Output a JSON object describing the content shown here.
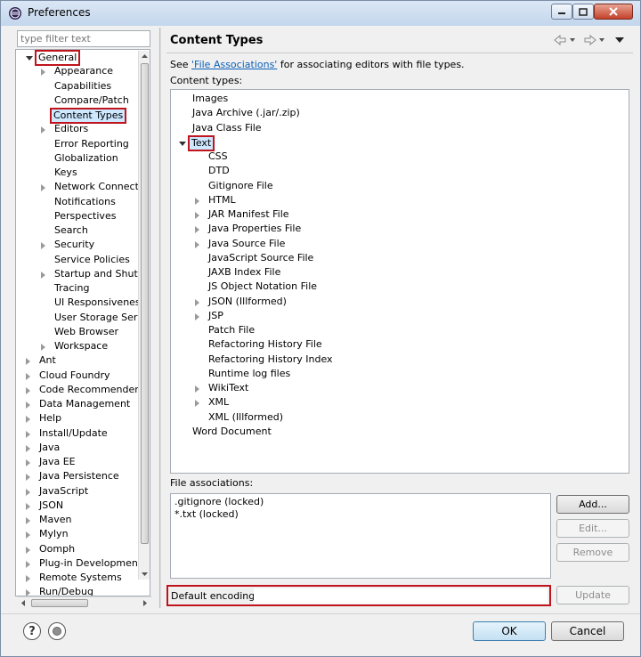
{
  "window": {
    "title": "Preferences",
    "buttons": [
      "minimize",
      "maximize",
      "close"
    ]
  },
  "left": {
    "filter_placeholder": "type filter text",
    "tree": [
      {
        "label": "General",
        "level": 0,
        "state": "expanded",
        "highlighted": true
      },
      {
        "label": "Appearance",
        "level": 1,
        "state": "collapsed"
      },
      {
        "label": "Capabilities",
        "level": 1,
        "state": "leaf"
      },
      {
        "label": "Compare/Patch",
        "level": 1,
        "state": "leaf"
      },
      {
        "label": "Content Types",
        "level": 1,
        "state": "leaf",
        "highlighted": true,
        "selected": true
      },
      {
        "label": "Editors",
        "level": 1,
        "state": "collapsed"
      },
      {
        "label": "Error Reporting",
        "level": 1,
        "state": "leaf"
      },
      {
        "label": "Globalization",
        "level": 1,
        "state": "leaf"
      },
      {
        "label": "Keys",
        "level": 1,
        "state": "leaf"
      },
      {
        "label": "Network Connection",
        "level": 1,
        "state": "collapsed"
      },
      {
        "label": "Notifications",
        "level": 1,
        "state": "leaf"
      },
      {
        "label": "Perspectives",
        "level": 1,
        "state": "leaf"
      },
      {
        "label": "Search",
        "level": 1,
        "state": "leaf"
      },
      {
        "label": "Security",
        "level": 1,
        "state": "collapsed"
      },
      {
        "label": "Service Policies",
        "level": 1,
        "state": "leaf"
      },
      {
        "label": "Startup and Shutdown",
        "level": 1,
        "state": "collapsed"
      },
      {
        "label": "Tracing",
        "level": 1,
        "state": "leaf"
      },
      {
        "label": "UI Responsiveness M",
        "level": 1,
        "state": "leaf"
      },
      {
        "label": "User Storage Service",
        "level": 1,
        "state": "leaf"
      },
      {
        "label": "Web Browser",
        "level": 1,
        "state": "leaf"
      },
      {
        "label": "Workspace",
        "level": 1,
        "state": "collapsed"
      },
      {
        "label": "Ant",
        "level": 0,
        "state": "collapsed"
      },
      {
        "label": "Cloud Foundry",
        "level": 0,
        "state": "collapsed"
      },
      {
        "label": "Code Recommenders",
        "level": 0,
        "state": "collapsed"
      },
      {
        "label": "Data Management",
        "level": 0,
        "state": "collapsed"
      },
      {
        "label": "Help",
        "level": 0,
        "state": "collapsed"
      },
      {
        "label": "Install/Update",
        "level": 0,
        "state": "collapsed"
      },
      {
        "label": "Java",
        "level": 0,
        "state": "collapsed"
      },
      {
        "label": "Java EE",
        "level": 0,
        "state": "collapsed"
      },
      {
        "label": "Java Persistence",
        "level": 0,
        "state": "collapsed"
      },
      {
        "label": "JavaScript",
        "level": 0,
        "state": "collapsed"
      },
      {
        "label": "JSON",
        "level": 0,
        "state": "collapsed"
      },
      {
        "label": "Maven",
        "level": 0,
        "state": "collapsed"
      },
      {
        "label": "Mylyn",
        "level": 0,
        "state": "collapsed"
      },
      {
        "label": "Oomph",
        "level": 0,
        "state": "collapsed"
      },
      {
        "label": "Plug-in Development",
        "level": 0,
        "state": "collapsed"
      },
      {
        "label": "Remote Systems",
        "level": 0,
        "state": "collapsed"
      },
      {
        "label": "Run/Debug",
        "level": 0,
        "state": "collapsed"
      }
    ]
  },
  "right": {
    "title": "Content Types",
    "desc_before": "See ",
    "desc_link": "'File Associations'",
    "desc_after": " for associating editors with file types.",
    "content_types_label": "Content types:",
    "content_types": [
      {
        "label": "Images",
        "level": 0,
        "state": "leaf"
      },
      {
        "label": "Java Archive (.jar/.zip)",
        "level": 0,
        "state": "leaf"
      },
      {
        "label": "Java Class File",
        "level": 0,
        "state": "leaf"
      },
      {
        "label": "Text",
        "level": 0,
        "state": "expanded",
        "highlighted": true,
        "selected": true
      },
      {
        "label": "CSS",
        "level": 1,
        "state": "leaf"
      },
      {
        "label": "DTD",
        "level": 1,
        "state": "leaf"
      },
      {
        "label": "Gitignore File",
        "level": 1,
        "state": "leaf"
      },
      {
        "label": "HTML",
        "level": 1,
        "state": "collapsed"
      },
      {
        "label": "JAR Manifest File",
        "level": 1,
        "state": "collapsed"
      },
      {
        "label": "Java Properties File",
        "level": 1,
        "state": "collapsed"
      },
      {
        "label": "Java Source File",
        "level": 1,
        "state": "collapsed"
      },
      {
        "label": "JavaScript Source File",
        "level": 1,
        "state": "leaf"
      },
      {
        "label": "JAXB Index File",
        "level": 1,
        "state": "leaf"
      },
      {
        "label": "JS Object Notation File",
        "level": 1,
        "state": "leaf"
      },
      {
        "label": "JSON (Illformed)",
        "level": 1,
        "state": "collapsed"
      },
      {
        "label": "JSP",
        "level": 1,
        "state": "collapsed"
      },
      {
        "label": "Patch File",
        "level": 1,
        "state": "leaf"
      },
      {
        "label": "Refactoring History File",
        "level": 1,
        "state": "leaf"
      },
      {
        "label": "Refactoring History Index",
        "level": 1,
        "state": "leaf"
      },
      {
        "label": "Runtime log files",
        "level": 1,
        "state": "leaf"
      },
      {
        "label": "WikiText",
        "level": 1,
        "state": "collapsed"
      },
      {
        "label": "XML",
        "level": 1,
        "state": "collapsed"
      },
      {
        "label": "XML (Illformed)",
        "level": 1,
        "state": "leaf"
      },
      {
        "label": "Word Document",
        "level": 0,
        "state": "leaf"
      }
    ],
    "file_assoc_label": "File associations:",
    "file_associations": [
      ".gitignore (locked)",
      "*.txt (locked)"
    ],
    "buttons": {
      "add": "Add...",
      "edit": "Edit...",
      "remove": "Remove",
      "update": "Update"
    },
    "encoding_label": "Default encoding:",
    "encoding_value": ""
  },
  "footer": {
    "ok": "OK",
    "cancel": "Cancel",
    "help_glyph": "?"
  },
  "colors": {
    "highlight_border": "#c0141c",
    "link": "#0b5fb8",
    "selection": "#cde8ff"
  }
}
